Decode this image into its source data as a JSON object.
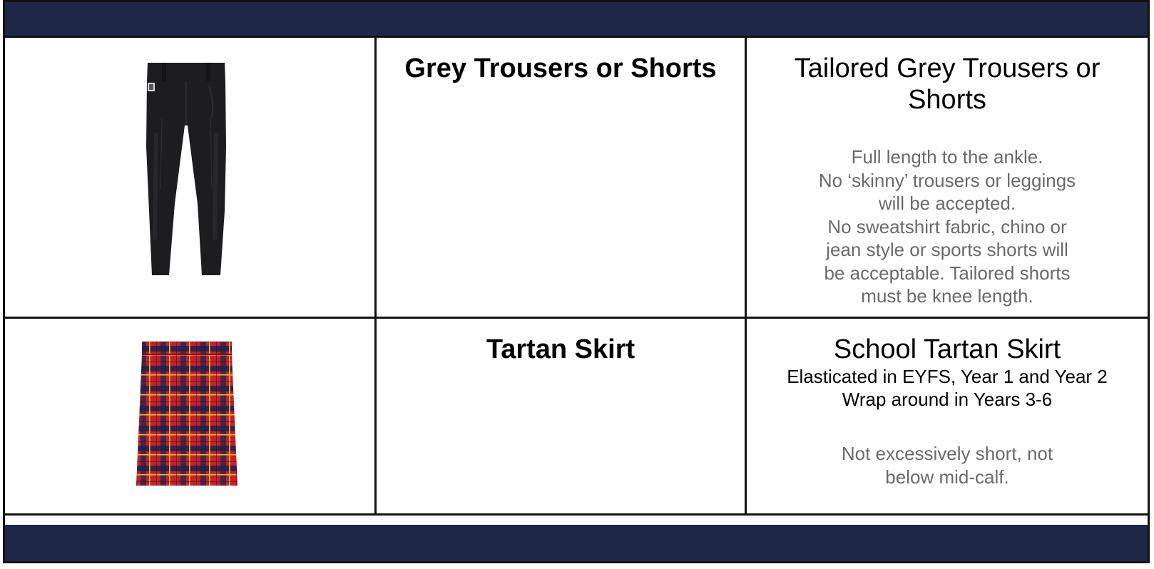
{
  "items": [
    {
      "name": "Grey Trousers or Shorts",
      "title": "Tailored Grey Trousers or Shorts",
      "subtitle_lines": [],
      "note_lines": [
        "Full length to the ankle.",
        "No ‘skinny’ trousers or leggings",
        "will be accepted.",
        "No sweatshirt fabric, chino or",
        "jean style or sports shorts will",
        "be acceptable. Tailored shorts",
        "must be knee length."
      ],
      "image_icon": "grey-trousers-image"
    },
    {
      "name": "Tartan Skirt",
      "title": "School Tartan Skirt",
      "subtitle_lines": [
        "Elasticated in EYFS, Year 1 and Year 2",
        "Wrap around in Years 3-6"
      ],
      "note_lines": [
        "Not excessively short, not",
        "below mid-calf."
      ],
      "image_icon": "tartan-skirt-image"
    }
  ],
  "colors": {
    "header_bar": "#1f2746",
    "grid_line": "#111111",
    "note_text": "#6a6a6a",
    "trousers": "#1d1d1f",
    "tartan_red": "#c8202c",
    "tartan_navy": "#1a2250",
    "tartan_yellow": "#e6c629"
  }
}
